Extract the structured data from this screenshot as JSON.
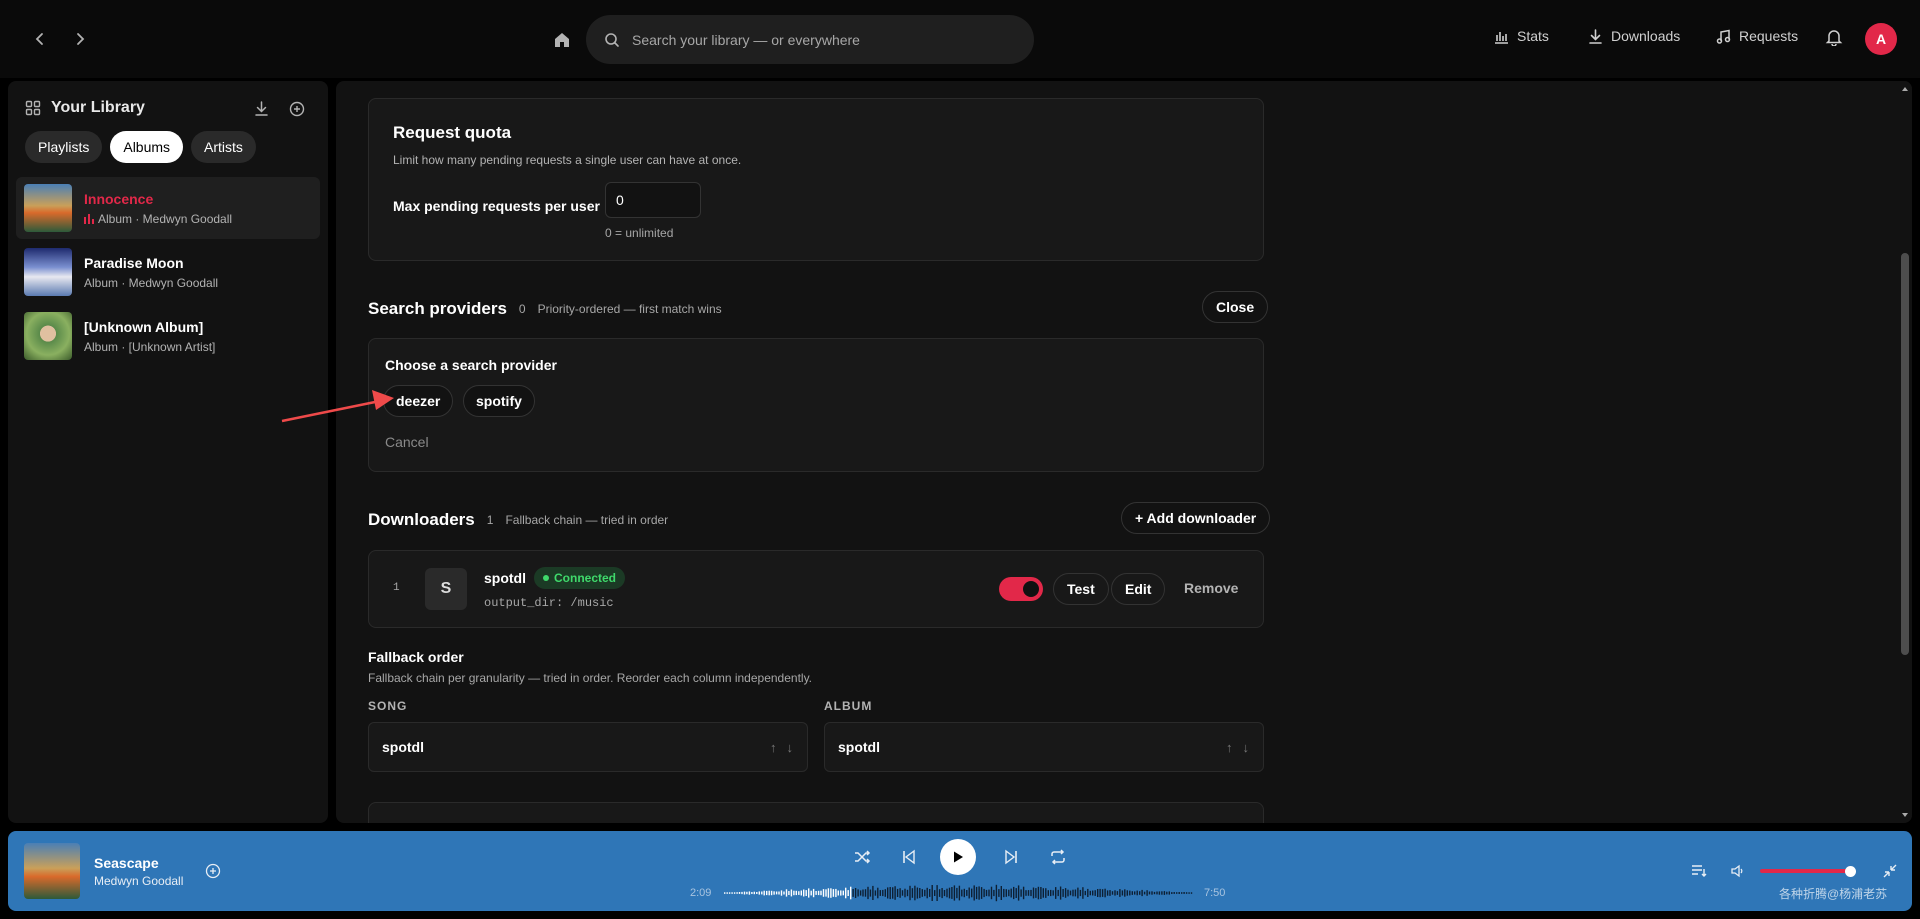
{
  "topbar": {
    "search_placeholder": "Search your library — or everywhere",
    "links": [
      {
        "label": "Stats",
        "icon": "bar-chart-icon"
      },
      {
        "label": "Downloads",
        "icon": "download-icon"
      },
      {
        "label": "Requests",
        "icon": "music-note-icon"
      }
    ],
    "avatar_initial": "A"
  },
  "sidebar": {
    "title": "Your Library",
    "filters": [
      "Playlists",
      "Albums",
      "Artists"
    ],
    "active_filter": "Albums",
    "items": [
      {
        "title": "Innocence",
        "subtitle": "Album · Medwyn Goodall",
        "playing": true
      },
      {
        "title": "Paradise Moon",
        "subtitle": "Album · Medwyn Goodall",
        "playing": false
      },
      {
        "title": "[Unknown Album]",
        "subtitle": "Album · [Unknown Artist]",
        "playing": false
      }
    ]
  },
  "request_quota": {
    "title": "Request quota",
    "description": "Limit how many pending requests a single user can have at once.",
    "field_label": "Max pending requests per user",
    "field_value": "0",
    "field_hint": "0 = unlimited"
  },
  "search_providers": {
    "title": "Search providers",
    "count": "0",
    "note": "Priority-ordered — first match wins",
    "close_label": "Close",
    "chooser_title": "Choose a search provider",
    "options": [
      "deezer",
      "spotify"
    ],
    "cancel_label": "Cancel"
  },
  "downloaders": {
    "title": "Downloaders",
    "count": "1",
    "note": "Fallback chain — tried in order",
    "add_label": "+ Add downloader",
    "items": [
      {
        "index": "1",
        "letter": "S",
        "name": "spotdl",
        "status": "Connected",
        "config": "output_dir: /music",
        "enabled": true
      }
    ],
    "test_label": "Test",
    "edit_label": "Edit",
    "remove_label": "Remove"
  },
  "fallback_order": {
    "title": "Fallback order",
    "description": "Fallback chain per granularity — tried in order. Reorder each column independently.",
    "columns": [
      {
        "heading": "SONG",
        "value": "spotdl"
      },
      {
        "heading": "ALBUM",
        "value": "spotdl"
      }
    ]
  },
  "player": {
    "title": "Seascape",
    "artist": "Medwyn Goodall",
    "elapsed": "2:09",
    "duration": "7:50",
    "volume": 0.9
  },
  "watermark": "各种折腾@杨浦老苏",
  "colors": {
    "accent": "#e22849",
    "player_bg": "#2f76b7",
    "connected": "#3fd96b"
  }
}
